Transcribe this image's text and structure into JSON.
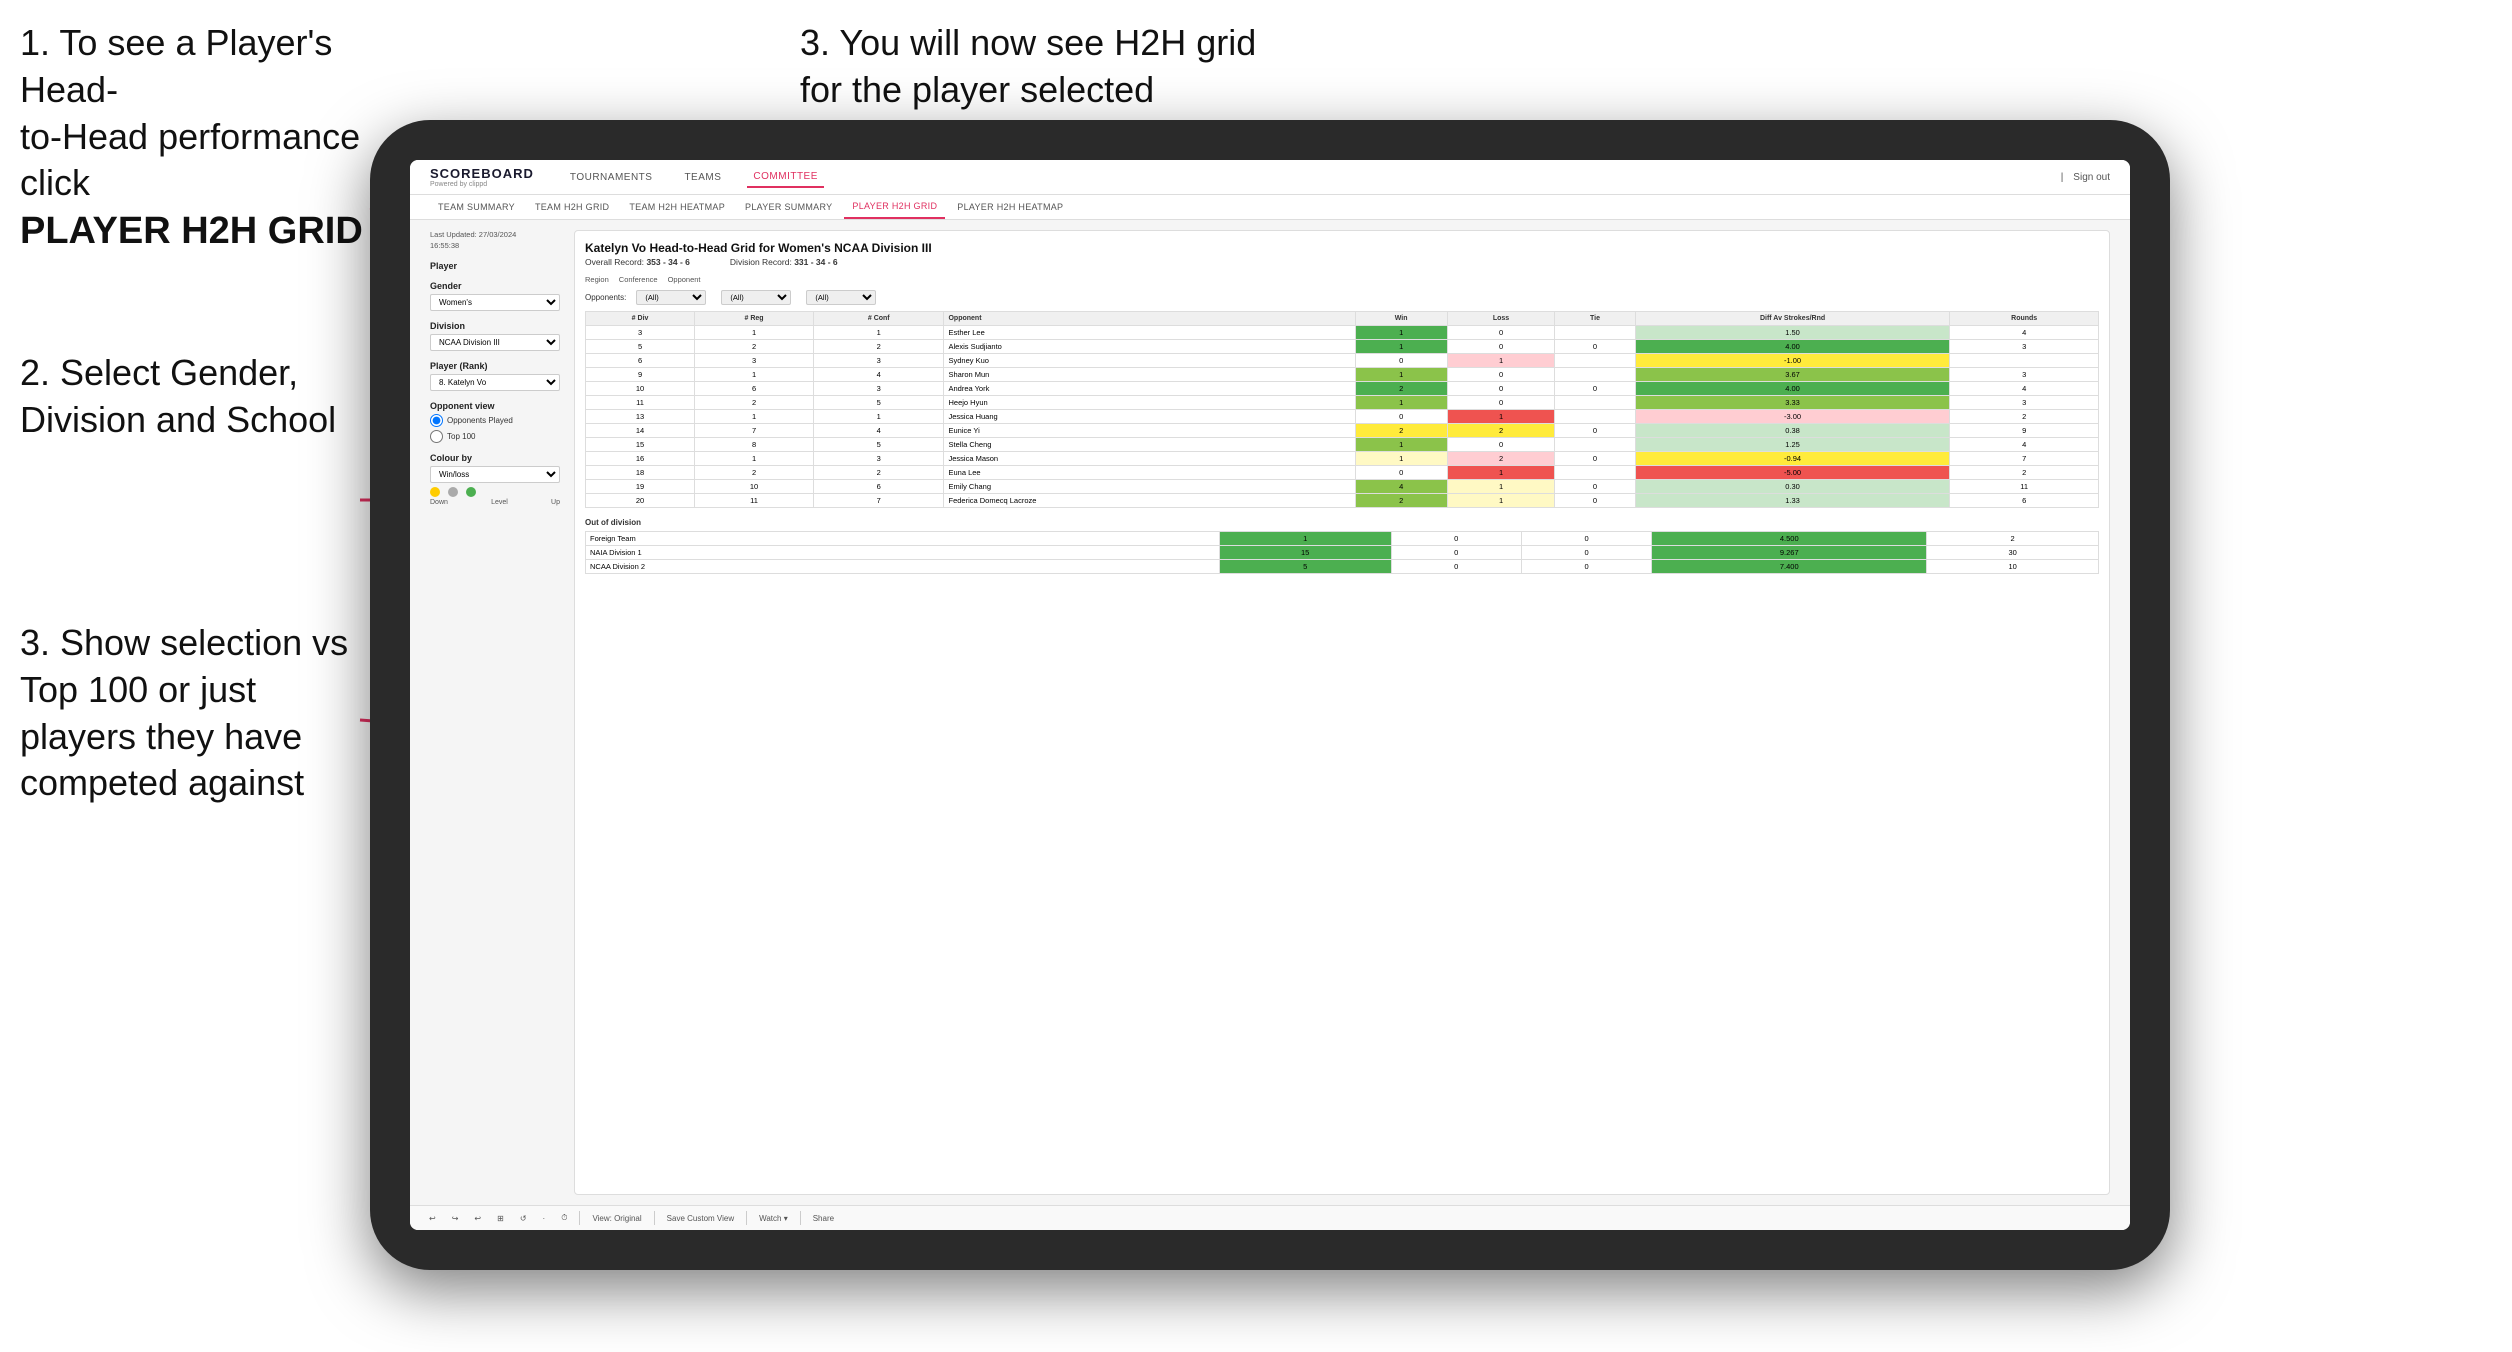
{
  "annotations": {
    "ann1": {
      "line1": "1. To see a Player's Head-",
      "line2": "to-Head performance click",
      "bold": "PLAYER H2H GRID"
    },
    "ann2": {
      "text": "2. Select Gender, Division and School"
    },
    "ann3_top": {
      "text": "3. You will now see H2H grid for the player selected"
    },
    "ann3_bot": {
      "text": "3. Show selection vs Top 100 or just players they have competed against"
    }
  },
  "nav": {
    "logo": "SCOREBOARD",
    "logo_sub": "Powered by clippd",
    "items": [
      "TOURNAMENTS",
      "TEAMS",
      "COMMITTEE"
    ],
    "active": "COMMITTEE",
    "sign_out": "Sign out"
  },
  "sub_nav": {
    "items": [
      "TEAM SUMMARY",
      "TEAM H2H GRID",
      "TEAM H2H HEATMAP",
      "PLAYER SUMMARY",
      "PLAYER H2H GRID",
      "PLAYER H2H HEATMAP"
    ],
    "active": "PLAYER H2H GRID"
  },
  "left_panel": {
    "last_updated_label": "Last Updated: 27/03/2024",
    "last_updated_time": "16:55:38",
    "player_label": "Player",
    "gender_label": "Gender",
    "gender_value": "Women's",
    "division_label": "Division",
    "division_value": "NCAA Division III",
    "player_rank_label": "Player (Rank)",
    "player_rank_value": "8. Katelyn Vo",
    "opponent_view_label": "Opponent view",
    "opponent_played": "Opponents Played",
    "top_100": "Top 100",
    "colour_by_label": "Colour by",
    "colour_by_value": "Win/loss",
    "legend_labels": [
      "Down",
      "Level",
      "Up"
    ]
  },
  "grid": {
    "title": "Katelyn Vo Head-to-Head Grid for Women's NCAA Division III",
    "overall_record_label": "Overall Record:",
    "overall_record": "353 - 34 - 6",
    "division_record_label": "Division Record:",
    "division_record": "331 - 34 - 6",
    "region_label": "Region",
    "conference_label": "Conference",
    "opponent_label": "Opponent",
    "opponents_label": "Opponents:",
    "opponents_value": "(All)",
    "conference_value": "(All)",
    "opponent_value": "(All)",
    "col_headers": [
      "# Div",
      "# Reg",
      "# Conf",
      "Opponent",
      "Win",
      "Loss",
      "Tie",
      "Diff Av Strokes/Rnd",
      "Rounds"
    ],
    "rows": [
      {
        "div": "3",
        "reg": "1",
        "conf": "1",
        "name": "Esther Lee",
        "win": "1",
        "loss": "0",
        "tie": "",
        "diff": "1.50",
        "rounds": "4",
        "win_color": "green-dark",
        "loss_color": "white",
        "tie_color": "white",
        "diff_color": "green-light"
      },
      {
        "div": "5",
        "reg": "2",
        "conf": "2",
        "name": "Alexis Sudjianto",
        "win": "1",
        "loss": "0",
        "tie": "0",
        "diff": "4.00",
        "rounds": "3",
        "win_color": "green-dark",
        "loss_color": "white",
        "tie_color": "white",
        "diff_color": "green-dark"
      },
      {
        "div": "6",
        "reg": "3",
        "conf": "3",
        "name": "Sydney Kuo",
        "win": "0",
        "loss": "1",
        "tie": "",
        "diff": "-1.00",
        "rounds": "",
        "win_color": "white",
        "loss_color": "red-light",
        "tie_color": "white",
        "diff_color": "yellow"
      },
      {
        "div": "9",
        "reg": "1",
        "conf": "4",
        "name": "Sharon Mun",
        "win": "1",
        "loss": "0",
        "tie": "",
        "diff": "3.67",
        "rounds": "3",
        "win_color": "green",
        "loss_color": "white",
        "tie_color": "white",
        "diff_color": "green"
      },
      {
        "div": "10",
        "reg": "6",
        "conf": "3",
        "name": "Andrea York",
        "win": "2",
        "loss": "0",
        "tie": "0",
        "diff": "4.00",
        "rounds": "4",
        "win_color": "green-dark",
        "loss_color": "white",
        "tie_color": "white",
        "diff_color": "green-dark"
      },
      {
        "div": "11",
        "reg": "2",
        "conf": "5",
        "name": "Heejo Hyun",
        "win": "1",
        "loss": "0",
        "tie": "",
        "diff": "3.33",
        "rounds": "3",
        "win_color": "green",
        "loss_color": "white",
        "tie_color": "white",
        "diff_color": "green"
      },
      {
        "div": "13",
        "reg": "1",
        "conf": "1",
        "name": "Jessica Huang",
        "win": "0",
        "loss": "1",
        "tie": "",
        "diff": "-3.00",
        "rounds": "2",
        "win_color": "white",
        "loss_color": "red",
        "tie_color": "white",
        "diff_color": "red-light"
      },
      {
        "div": "14",
        "reg": "7",
        "conf": "4",
        "name": "Eunice Yi",
        "win": "2",
        "loss": "2",
        "tie": "0",
        "diff": "0.38",
        "rounds": "9",
        "win_color": "yellow",
        "loss_color": "yellow",
        "tie_color": "white",
        "diff_color": "green-light"
      },
      {
        "div": "15",
        "reg": "8",
        "conf": "5",
        "name": "Stella Cheng",
        "win": "1",
        "loss": "0",
        "tie": "",
        "diff": "1.25",
        "rounds": "4",
        "win_color": "green",
        "loss_color": "white",
        "tie_color": "white",
        "diff_color": "green-light"
      },
      {
        "div": "16",
        "reg": "1",
        "conf": "3",
        "name": "Jessica Mason",
        "win": "1",
        "loss": "2",
        "tie": "0",
        "diff": "-0.94",
        "rounds": "7",
        "win_color": "yellow-light",
        "loss_color": "red-light",
        "tie_color": "white",
        "diff_color": "yellow"
      },
      {
        "div": "18",
        "reg": "2",
        "conf": "2",
        "name": "Euna Lee",
        "win": "0",
        "loss": "1",
        "tie": "",
        "diff": "-5.00",
        "rounds": "2",
        "win_color": "white",
        "loss_color": "red",
        "tie_color": "white",
        "diff_color": "red"
      },
      {
        "div": "19",
        "reg": "10",
        "conf": "6",
        "name": "Emily Chang",
        "win": "4",
        "loss": "1",
        "tie": "0",
        "diff": "0.30",
        "rounds": "11",
        "win_color": "green",
        "loss_color": "yellow-light",
        "tie_color": "white",
        "diff_color": "green-light"
      },
      {
        "div": "20",
        "reg": "11",
        "conf": "7",
        "name": "Federica Domecq Lacroze",
        "win": "2",
        "loss": "1",
        "tie": "0",
        "diff": "1.33",
        "rounds": "6",
        "win_color": "green",
        "loss_color": "yellow-light",
        "tie_color": "white",
        "diff_color": "green-light"
      }
    ],
    "out_of_division_label": "Out of division",
    "out_rows": [
      {
        "name": "Foreign Team",
        "win": "1",
        "loss": "0",
        "tie": "0",
        "diff": "4.500",
        "rounds": "2",
        "win_color": "green-dark",
        "diff_color": "green-dark"
      },
      {
        "name": "NAIA Division 1",
        "win": "15",
        "loss": "0",
        "tie": "0",
        "diff": "9.267",
        "rounds": "30",
        "win_color": "green-dark",
        "diff_color": "green-dark"
      },
      {
        "name": "NCAA Division 2",
        "win": "5",
        "loss": "0",
        "tie": "0",
        "diff": "7.400",
        "rounds": "10",
        "win_color": "green-dark",
        "diff_color": "green-dark"
      }
    ]
  },
  "toolbar": {
    "items": [
      "↩",
      "↪",
      "↩",
      "⊞",
      "↺",
      "·",
      "⏱",
      "View: Original",
      "Save Custom View",
      "Watch ▾",
      "↔",
      "Share"
    ]
  }
}
